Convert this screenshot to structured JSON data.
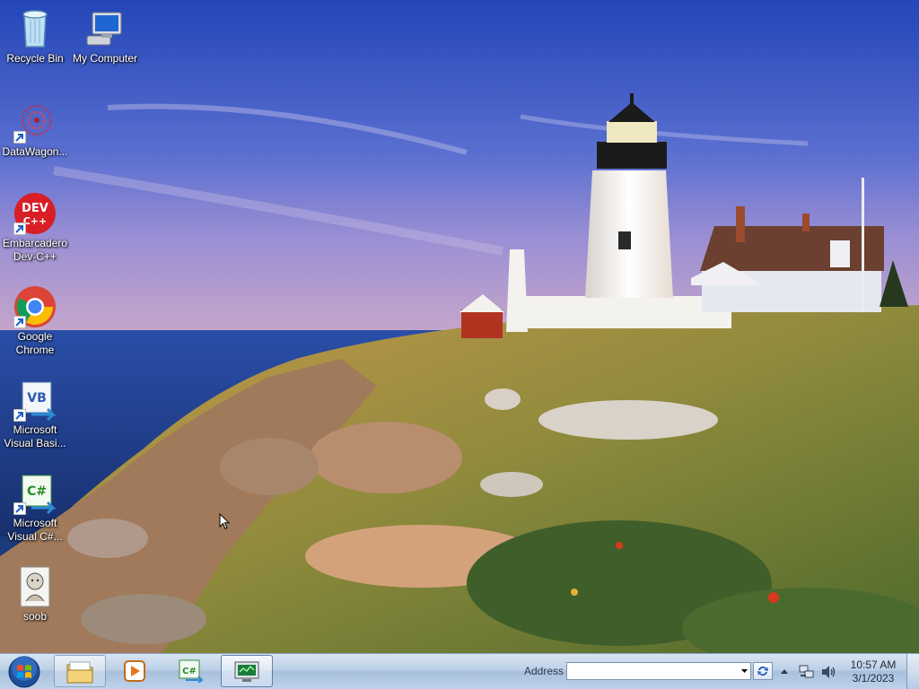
{
  "desktop": {
    "wallpaper": "lighthouse coastline at sunset",
    "icons": [
      {
        "label": "Recycle Bin",
        "icon": "recycle-bin-icon"
      },
      {
        "label": "My Computer",
        "icon": "computer-icon"
      },
      {
        "label": "DataWagon...",
        "icon": "datawagon-icon",
        "shortcut": true
      },
      {
        "label": "Embarcadero\nDev-C++",
        "label_line1": "Embarcadero",
        "label_line2": "Dev-C++",
        "icon": "devcpp-icon",
        "shortcut": true
      },
      {
        "label_line1": "Google",
        "label_line2": "Chrome",
        "icon": "chrome-icon",
        "shortcut": true
      },
      {
        "label_line1": "Microsoft",
        "label_line2": "Visual Basi...",
        "icon": "visual-basic-icon",
        "shortcut": true
      },
      {
        "label_line1": "Microsoft",
        "label_line2": "Visual C#...",
        "icon": "visual-csharp-icon",
        "shortcut": true
      },
      {
        "label": "soob",
        "icon": "soob-image-icon"
      }
    ]
  },
  "taskbar": {
    "start": "start-orb-icon",
    "buttons": [
      {
        "name": "windows-explorer",
        "icon": "folder-icon"
      },
      {
        "name": "media-player",
        "icon": "media-player-icon"
      },
      {
        "name": "visual-csharp",
        "icon": "csharp-icon"
      },
      {
        "name": "remote-computer",
        "icon": "monitor-icon"
      }
    ],
    "address_label": "Address",
    "address_value": "",
    "clock_time": "10:57 AM",
    "clock_date": "3/1/2023"
  },
  "colors": {
    "sky": "#3b5fc8",
    "sea": "#1f3f8f",
    "taskbar": "#bcd0e6",
    "icon_label": "#ffffff"
  }
}
